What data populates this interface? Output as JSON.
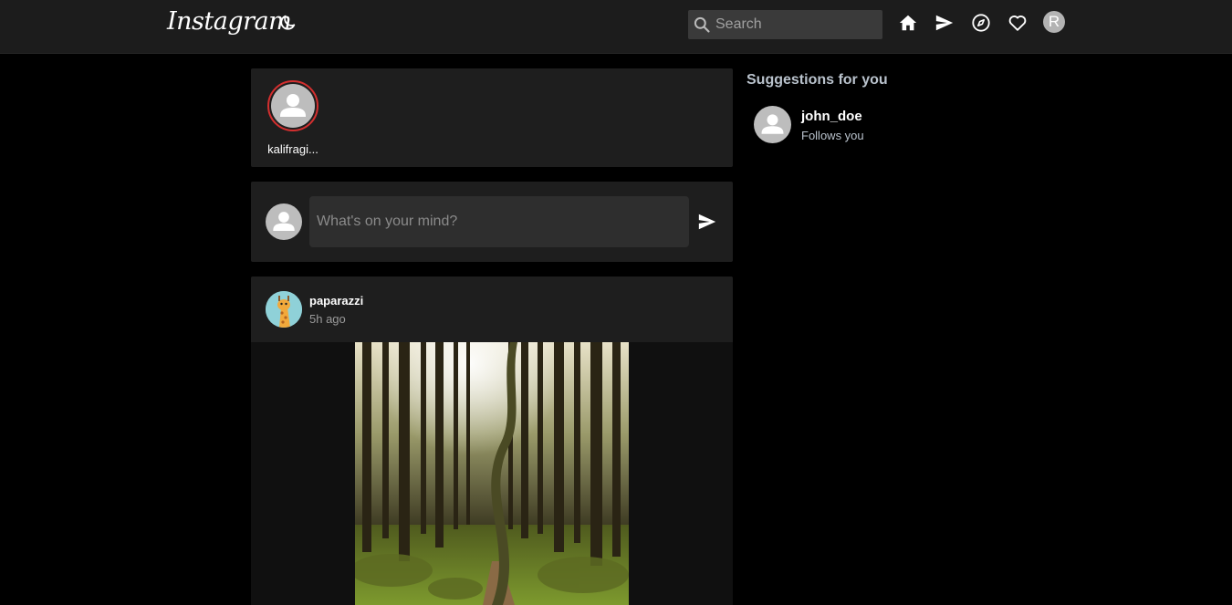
{
  "header": {
    "logo": "Instagram",
    "search_placeholder": "Search",
    "avatar_initial": "R",
    "icons": [
      "moon-icon",
      "home-icon",
      "send-icon",
      "compass-icon",
      "heart-icon"
    ]
  },
  "stories": [
    {
      "name": "kalifragi..."
    }
  ],
  "composer": {
    "placeholder": "What's on your mind?"
  },
  "post": {
    "username": "paparazzi",
    "time": "5h ago",
    "image": "forest-path-photo"
  },
  "suggestions": {
    "title": "Suggestions for you",
    "items": [
      {
        "username": "john_doe",
        "subtitle": "Follows you"
      }
    ]
  },
  "colors": {
    "background": "#000000",
    "card": "#1e1e1e",
    "topbar": "#1c1c1c",
    "story_ring": "#d32f2f",
    "muted_text": "#b9c2cc"
  }
}
